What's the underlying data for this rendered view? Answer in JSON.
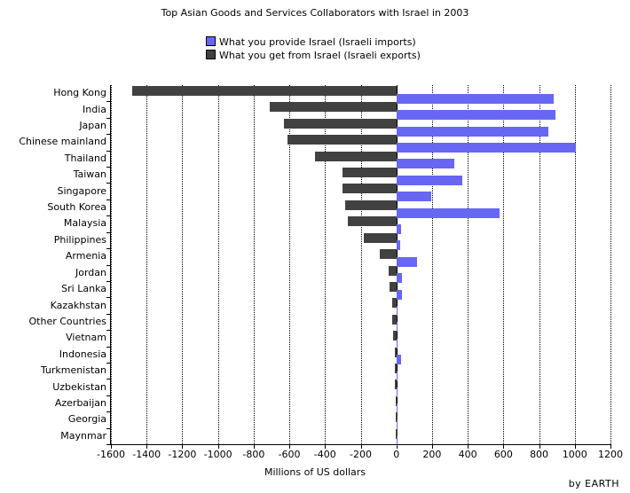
{
  "title": "Top Asian Goods and Services Collaborators with Israel in 2003",
  "legend": {
    "items": [
      {
        "label": "What you provide Israel (Israeli imports)",
        "color": "#6767f4",
        "key": "imports"
      },
      {
        "label": "What you get from Israel (Israeli exports)",
        "color": "#414141",
        "key": "exports"
      }
    ]
  },
  "axis": {
    "xlabel": "Millions of US dollars",
    "ticks": [
      "-1600",
      "-1400",
      "-1200",
      "-1000",
      "-800",
      "-600",
      "-400",
      "-200",
      "0",
      "200",
      "400",
      "600",
      "800",
      "1000",
      "1200"
    ]
  },
  "credit": "by EARTH",
  "colors": {
    "imports": "#6767f4",
    "exports": "#414141",
    "axis": "#000000",
    "background": "#ffffff"
  },
  "chart_data": {
    "type": "bar",
    "orientation": "horizontal",
    "title": "Top Asian Goods and Services Collaborators with Israel in 2003",
    "xlabel": "Millions of US dollars",
    "ylabel": "",
    "xlim": [
      -1600,
      1200
    ],
    "xticks": [
      -1600,
      -1400,
      -1200,
      -1000,
      -800,
      -600,
      -400,
      -200,
      0,
      200,
      400,
      600,
      800,
      1000,
      1200
    ],
    "grid": true,
    "legend_position": "top-center",
    "categories": [
      "Hong Kong",
      "India",
      "Japan",
      "Chinese mainland",
      "Thailand",
      "Taiwan",
      "Singapore",
      "South Korea",
      "Malaysia",
      "Philippines",
      "Armenia",
      "Jordan",
      "Sri Lanka",
      "Kazakhstan",
      "Other Countries",
      "Vietnam",
      "Indonesia",
      "Turkmenistan",
      "Uzbekistan",
      "Azerbaijan",
      "Georgia",
      "Maynmar"
    ],
    "series": [
      {
        "name": "What you provide Israel (Israeli imports)",
        "color": "#6767f4",
        "values": [
          880,
          890,
          850,
          1005,
          325,
          370,
          195,
          580,
          25,
          20,
          115,
          30,
          30,
          5,
          5,
          5,
          25,
          2,
          2,
          2,
          0,
          0
        ]
      },
      {
        "name": "What you get from Israel (Israeli exports)",
        "color": "#414141",
        "values": [
          -1480,
          -710,
          -630,
          -610,
          -455,
          -300,
          -300,
          -285,
          -270,
          -185,
          -95,
          -45,
          -40,
          -25,
          -25,
          -20,
          -10,
          -8,
          -8,
          -5,
          -3,
          -2
        ]
      }
    ]
  }
}
